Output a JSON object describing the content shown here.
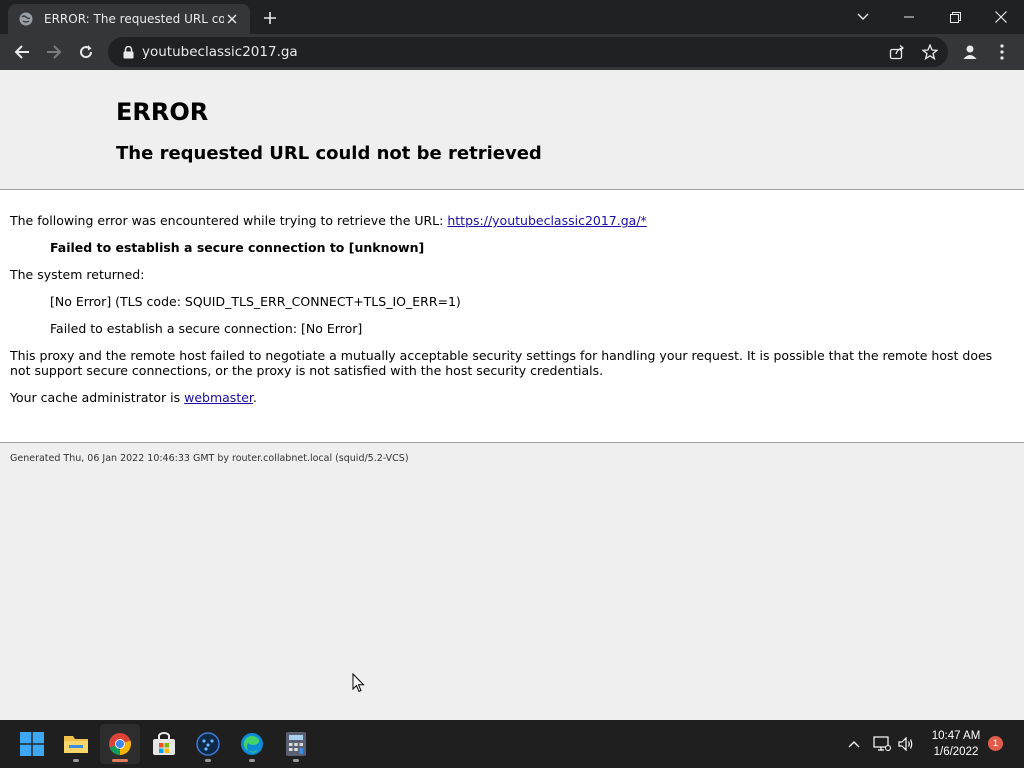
{
  "browser": {
    "tab_title": "ERROR: The requested URL could not be retrieved",
    "url": "youtubeclassic2017.ga"
  },
  "page": {
    "title": "ERROR",
    "subtitle": "The requested URL could not be retrieved",
    "intro_text": "The following error was encountered while trying to retrieve the URL: ",
    "intro_link": "https://youtubeclassic2017.ga/*",
    "error_bold": "Failed to establish a secure connection to [unknown]",
    "system_returned": "The system returned:",
    "tls_code": "[No Error] (TLS code: SQUID_TLS_ERR_CONNECT+TLS_IO_ERR=1)",
    "secure_conn": "Failed to establish a secure connection: [No Error]",
    "explanation": "This proxy and the remote host failed to negotiate a mutually acceptable security settings for handling your request. It is possible that the remote host does not support secure connections, or the proxy is not satisfied with the host security credentials.",
    "admin_prefix": "Your cache administrator is ",
    "admin_link": "webmaster",
    "admin_suffix": ".",
    "generated": "Generated Thu, 06 Jan 2022 10:46:33 GMT by router.collabnet.local (squid/5.2-VCS)"
  },
  "taskbar": {
    "apps": [
      "start-icon",
      "file-explorer-icon",
      "chrome-icon",
      "store-icon",
      "app-icon",
      "edge-icon",
      "calculator-icon"
    ],
    "time": "10:47 AM",
    "date": "1/6/2022",
    "notification_count": "1"
  },
  "colors": {
    "tab_bg": "#35363a",
    "titlebar_bg": "#202124",
    "link": "#1a0dab",
    "taskbar_bg": "#1f1f1f",
    "badge": "#e25c4b"
  }
}
